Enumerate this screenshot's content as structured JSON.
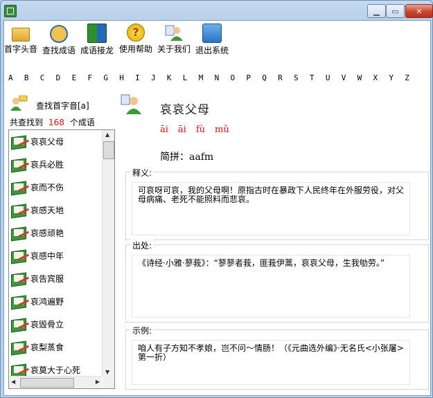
{
  "toolbar": {
    "buttons": [
      {
        "label": "首字头音",
        "icon": "folder-icon"
      },
      {
        "label": "查找成语",
        "icon": "search-icon"
      },
      {
        "label": "成语接龙",
        "icon": "books-icon"
      },
      {
        "label": "使用帮助",
        "icon": "help-icon"
      },
      {
        "label": "关于我们",
        "icon": "about-icon"
      },
      {
        "label": "退出系统",
        "icon": "exit-icon"
      }
    ]
  },
  "alphabet": [
    "A",
    "B",
    "C",
    "D",
    "E",
    "F",
    "G",
    "H",
    "I",
    "J",
    "K",
    "L",
    "M",
    "N",
    "O",
    "P",
    "Q",
    "R",
    "S",
    "T",
    "U",
    "V",
    "W",
    "X",
    "Y",
    "Z"
  ],
  "search": {
    "label": "查找首字音[a]",
    "found_prefix": "共查找到",
    "found_count": "168",
    "found_suffix": "个成语"
  },
  "idiom_list": [
    "哀哀父母",
    "哀兵必胜",
    "哀而不伤",
    "哀感天地",
    "哀感顽艳",
    "哀感中年",
    "哀告宾服",
    "哀鸿遍野",
    "哀毁骨立",
    "哀梨蒸食",
    "哀莫大于心死"
  ],
  "detail": {
    "title": "哀哀父母",
    "pinyin": [
      "āi",
      "āi",
      "fù",
      "mǔ"
    ],
    "abbr_label": "简拼：",
    "abbr_value": "aafm",
    "meaning_label": "释义:",
    "meaning_text": "可哀呀可哀，我的父母啊！原指古时在暴政下人民终年在外服劳役，对父母病痛、老死不能照料而悲哀。",
    "source_label": "出处:",
    "source_text": "《诗经·小雅·蓼莪》：“蓼蓼者莪，匪莪伊蒿，哀哀父母，生我劬劳。”",
    "example_label": "示例:",
    "example_text": "咱人有子方知不孝娘，岂不问～情肠！（《元曲选外编》·无名氏<小张屠>第一折）"
  },
  "colors": {
    "accent": "#d11111",
    "title_bar": "#b9d1ea"
  }
}
